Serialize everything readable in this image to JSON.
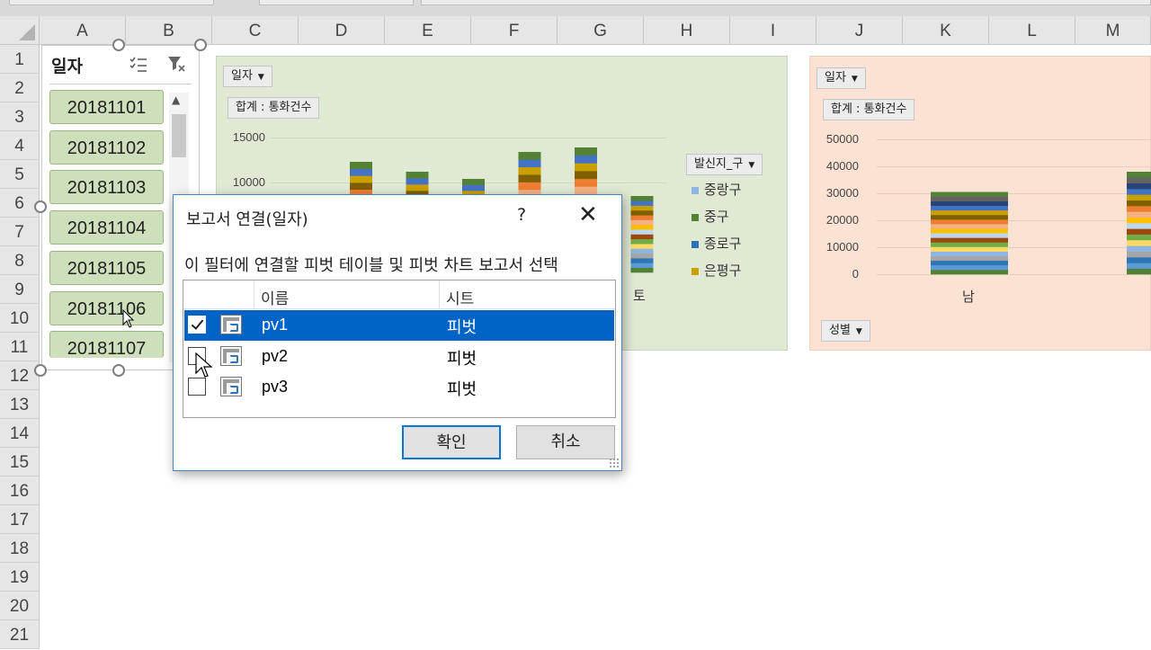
{
  "column_headers": [
    "A",
    "B",
    "C",
    "D",
    "E",
    "F",
    "G",
    "H",
    "I",
    "J",
    "K",
    "L",
    "M"
  ],
  "row_headers": [
    "1",
    "2",
    "3",
    "4",
    "5",
    "6",
    "7",
    "8",
    "9",
    "10",
    "11",
    "12",
    "13",
    "14",
    "15",
    "16",
    "17",
    "18",
    "19",
    "20",
    "21"
  ],
  "slicer": {
    "title": "일자",
    "items": [
      "20181101",
      "20181102",
      "20181103",
      "20181104",
      "20181105",
      "20181106",
      "20181107"
    ],
    "multiselect_icon": "multiselect-icon",
    "clear_filter_icon": "clear-filter-icon"
  },
  "chart1": {
    "filter_button": "일자",
    "value_button": "합계 : 통화건수",
    "legend_button": "발신지_구",
    "legend": [
      {
        "label": "중랑구",
        "color": "#8eb4e3"
      },
      {
        "label": "중구",
        "color": "#548235"
      },
      {
        "label": "종로구",
        "color": "#2e75b6"
      },
      {
        "label": "은평구",
        "color": "#c9a000"
      }
    ],
    "x_visible_label": "토",
    "background": "#dfe9d4"
  },
  "chart2": {
    "filter_button": "일자",
    "value_button": "합계 : 통화건수",
    "axis_button": "성별",
    "x_visible_label": "남",
    "background": "#fbe2d3"
  },
  "chart_data": [
    {
      "type": "bar",
      "stacked": true,
      "title": "",
      "ylabel": "",
      "yticks": [
        "15000",
        "10000"
      ],
      "ylim": [
        0,
        15000
      ],
      "categories": [
        "",
        "",
        "",
        "",
        "",
        "토"
      ],
      "values": [
        12300,
        11200,
        10400,
        13400,
        13900,
        8500
      ],
      "series": [
        {
          "name": "중랑구"
        },
        {
          "name": "중구"
        },
        {
          "name": "종로구"
        },
        {
          "name": "은평구"
        }
      ],
      "grid": true,
      "legend_position": "right"
    },
    {
      "type": "bar",
      "stacked": true,
      "title": "",
      "ylabel": "",
      "yticks": [
        "50000",
        "40000",
        "30000",
        "20000",
        "10000",
        "0"
      ],
      "ylim": [
        0,
        50000
      ],
      "categories": [
        "남",
        ""
      ],
      "values": [
        30500,
        38000
      ],
      "grid": true
    }
  ],
  "dialog": {
    "title": "보고서 연결(일자)",
    "help": "?",
    "close": "✕",
    "description": "이 필터에 연결할 피벗 테이블 및 피벗 차트 보고서 선택",
    "col_name": "이름",
    "col_sheet": "시트",
    "rows": [
      {
        "name": "pv1",
        "sheet": "피벗",
        "checked": true,
        "selected": true
      },
      {
        "name": "pv2",
        "sheet": "피벗",
        "checked": false,
        "selected": false
      },
      {
        "name": "pv3",
        "sheet": "피벗",
        "checked": false,
        "selected": false
      }
    ],
    "ok": "확인",
    "cancel": "취소"
  }
}
